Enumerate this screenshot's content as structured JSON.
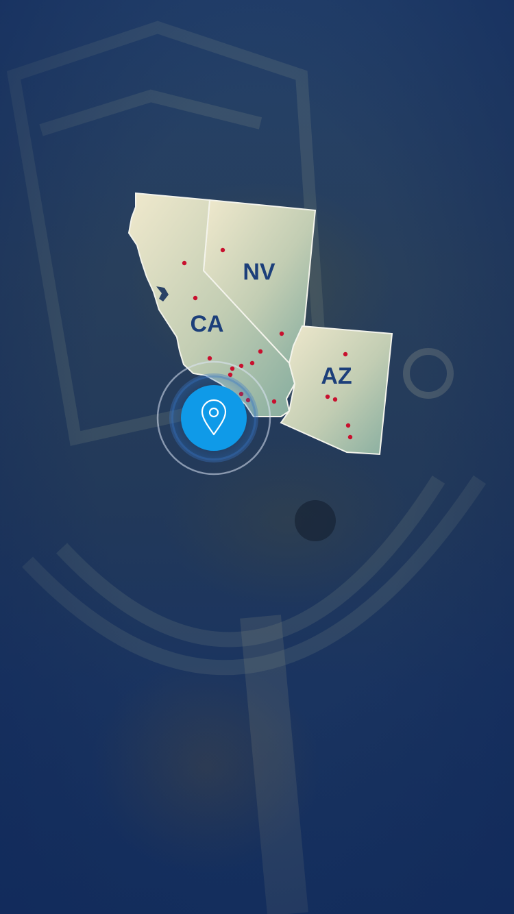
{
  "map": {
    "states": [
      {
        "code": "CA",
        "label": "CA"
      },
      {
        "code": "NV",
        "label": "NV"
      },
      {
        "code": "AZ",
        "label": "AZ"
      }
    ],
    "marker_color": "#c8102e",
    "pin_color": "#0f9ae8",
    "state_fill_light": "#ece6c8",
    "state_fill_dark": "#8ab0a2"
  }
}
